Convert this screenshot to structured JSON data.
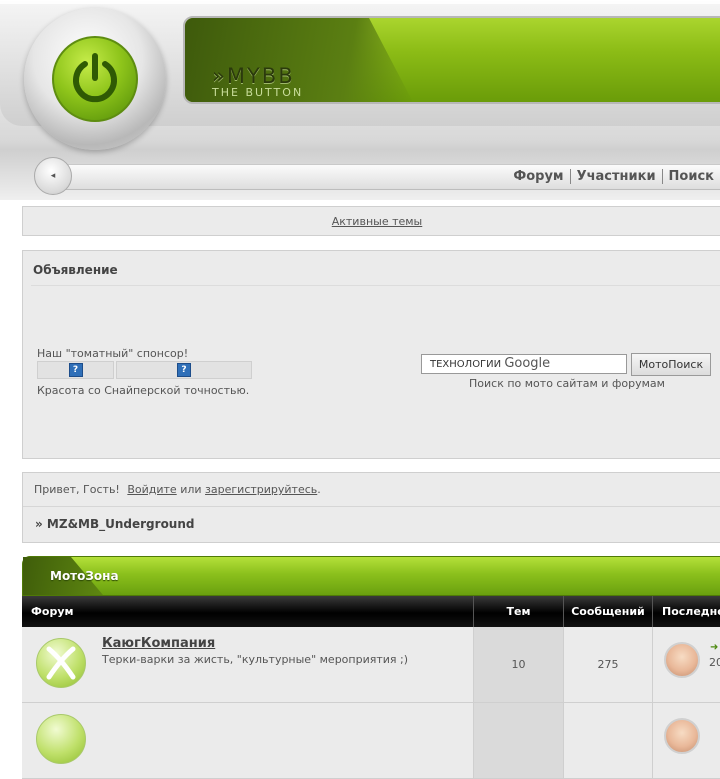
{
  "header": {
    "brand_title": "»MYBB",
    "brand_subtitle": "THE BUTTON"
  },
  "nav": {
    "items": [
      {
        "label": "Форум"
      },
      {
        "label": "Участники"
      },
      {
        "label": "Поиск"
      }
    ]
  },
  "active_topics": {
    "label": "Активные темы"
  },
  "announcement": {
    "title": "Объявление",
    "sponsor_text": "Наш \"томатный\" спонсор!",
    "sniper_text": "Красота со Снайперской точностью.",
    "search_input_value": "ТЕХНОЛОГИИ",
    "search_input_logo": "Google",
    "search_button": "МотоПоиск",
    "search_caption": "Поиск по мото сайтам и форумам"
  },
  "welcome": {
    "greeting": "Привет, Гость!",
    "login_link": "Войдите",
    "or_text": "или",
    "register_link": "зарегистрируйтесь",
    "end_period": ".",
    "breadcrumb": "» MZ&MB_Underground"
  },
  "category": {
    "title": "МотоЗона",
    "columns": {
      "forum": "Форум",
      "topics": "Тем",
      "posts": "Сообщений",
      "last": "Последне"
    },
    "forums": [
      {
        "name": "КаюгКомпания",
        "description": "Терки-варки за жисть, \"культурные\" мероприятия ;)",
        "topics": "10",
        "posts": "275",
        "last_fragment": "20"
      }
    ]
  },
  "colors": {
    "accent_green": "#8bc01c",
    "dark_green": "#3f5d0a",
    "table_header": "#000000"
  }
}
